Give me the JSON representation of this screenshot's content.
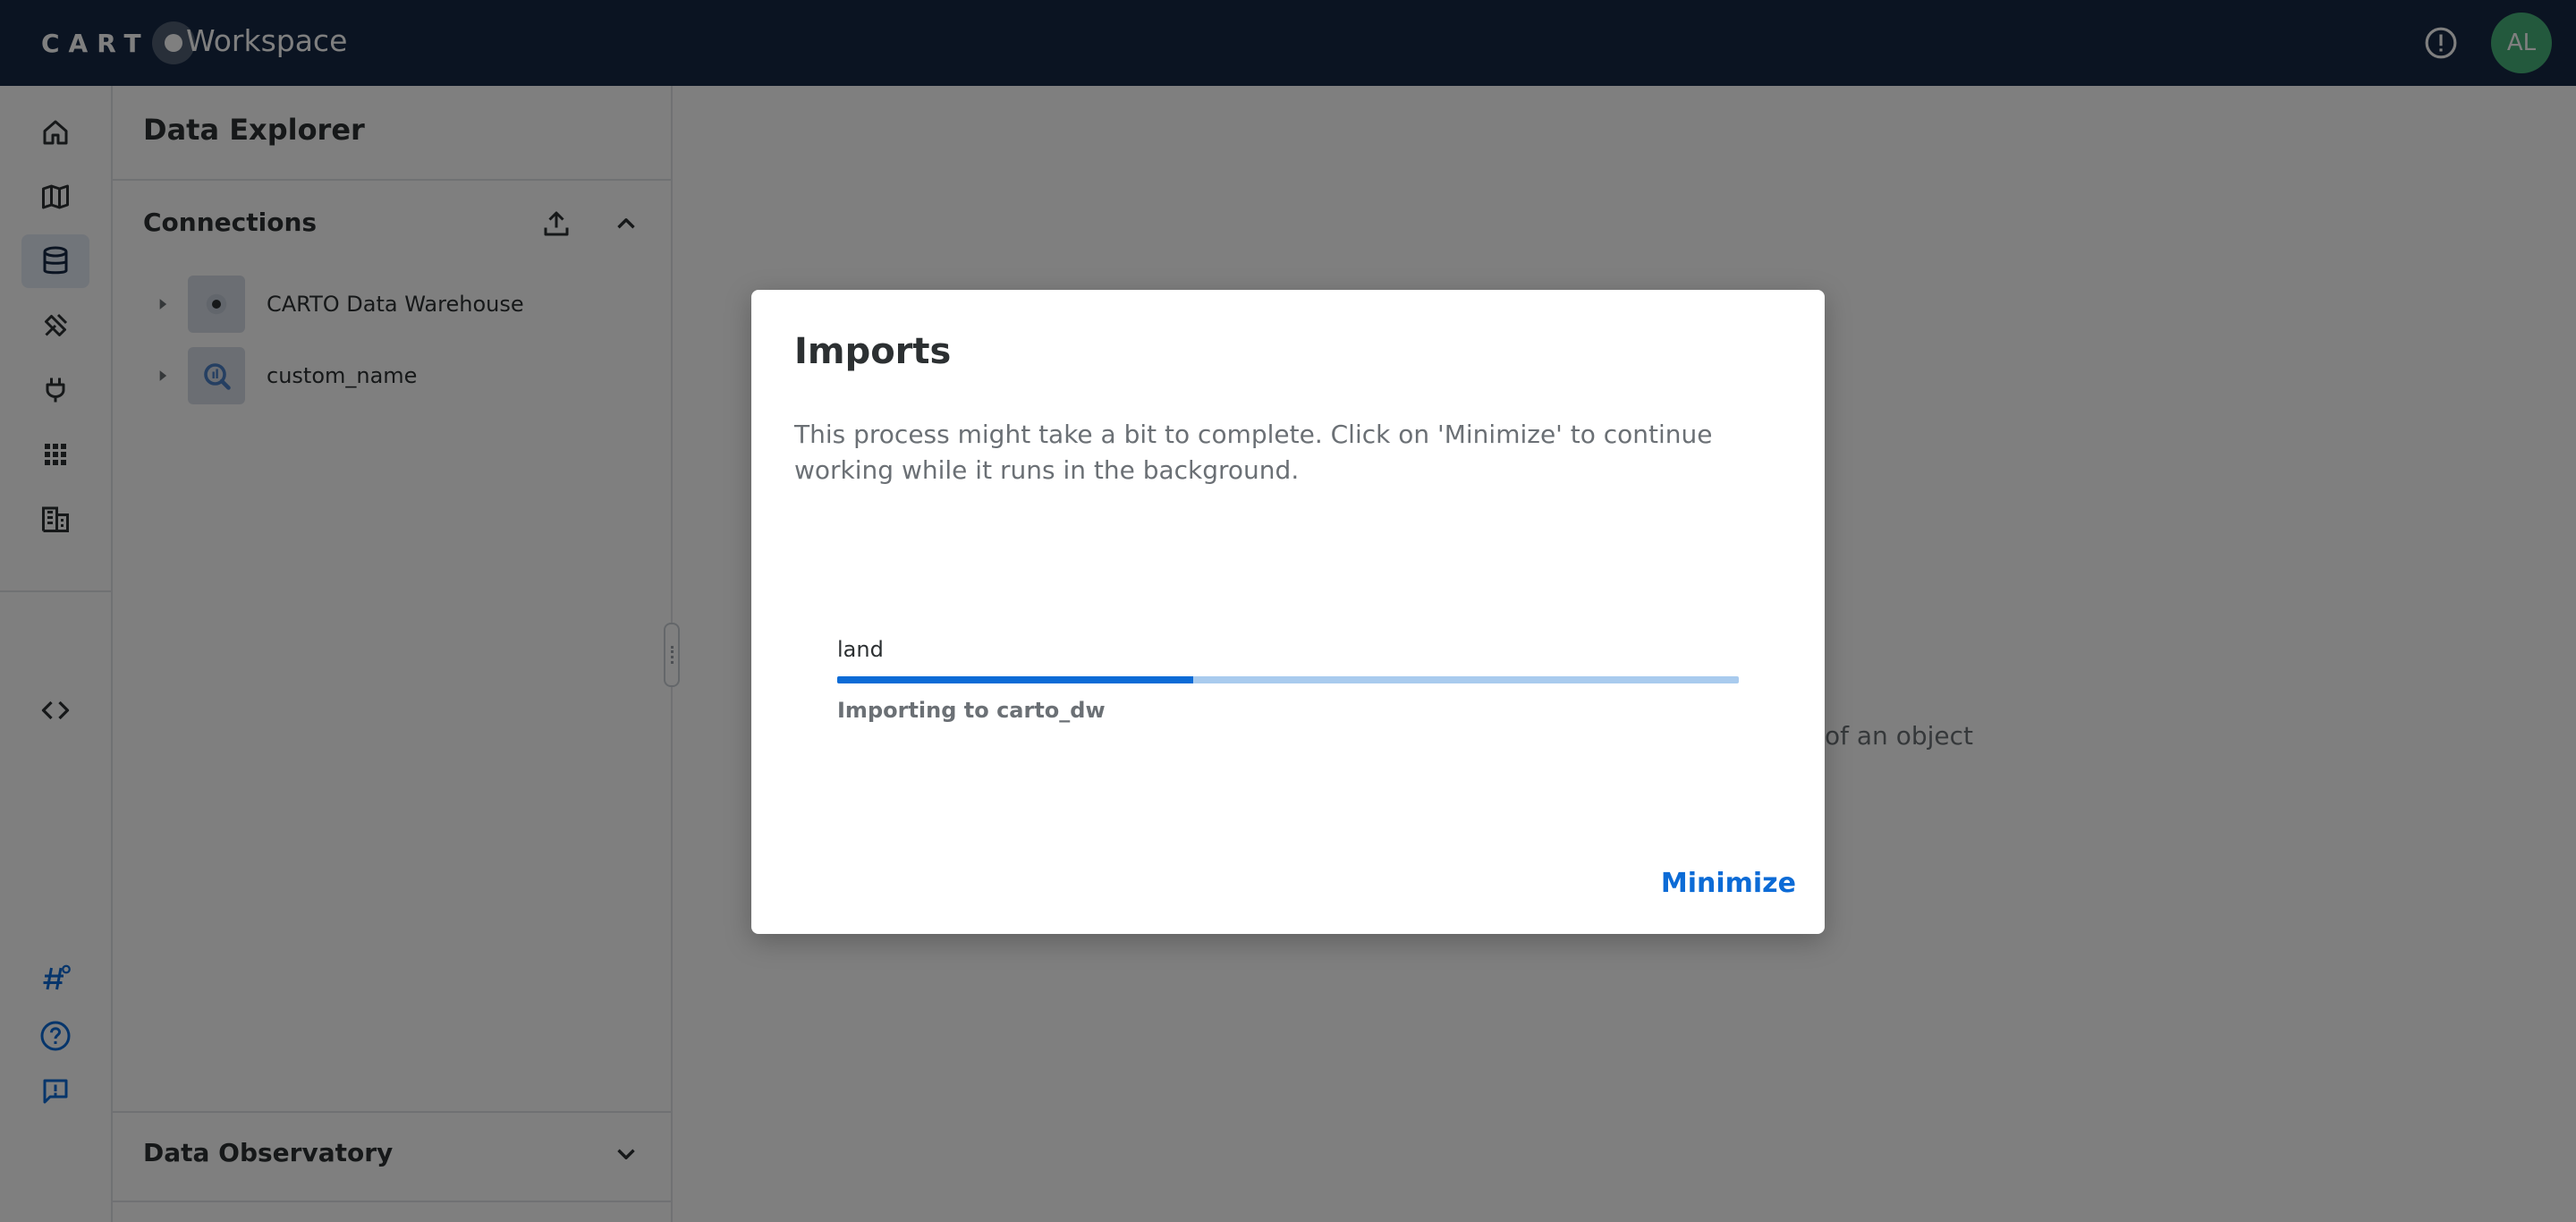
{
  "app": {
    "logo_text": "CART",
    "workspace_label": "Workspace",
    "user_initials": "AL"
  },
  "rail": {
    "items": [
      {
        "name": "home-icon",
        "active": false
      },
      {
        "name": "maps-icon",
        "active": false
      },
      {
        "name": "data-explorer-icon",
        "active": true
      },
      {
        "name": "workflows-icon",
        "active": false
      },
      {
        "name": "connections-icon",
        "active": false
      },
      {
        "name": "applications-icon",
        "active": false
      },
      {
        "name": "organization-icon",
        "active": false
      },
      {
        "name": "developers-icon",
        "active": false
      }
    ]
  },
  "panel": {
    "title": "Data Explorer",
    "connections_title": "Connections",
    "connections": [
      {
        "label": "CARTO Data Warehouse"
      },
      {
        "label": "custom_name"
      }
    ],
    "observatory_title": "Data Observatory"
  },
  "main": {
    "hint_text": "of an object"
  },
  "dialog": {
    "title": "Imports",
    "description": "This process might take a bit to complete. Click on 'Minimize' to continue working while it runs in the background.",
    "file_name": "land",
    "progress_percent": 39.5,
    "progress_caption": "Importing to carto_dw",
    "minimize_label": "Minimize"
  },
  "colors": {
    "topbar": "#162945",
    "accent": "#0c6bd6",
    "avatar": "#47b27a"
  }
}
